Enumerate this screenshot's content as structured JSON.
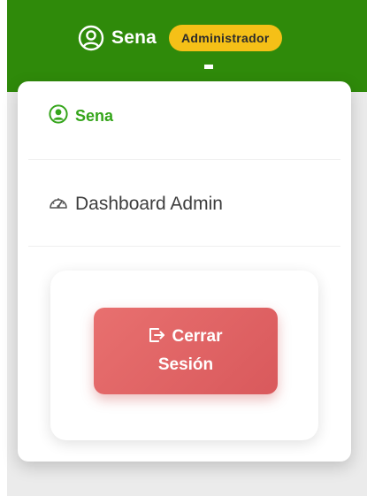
{
  "header": {
    "user_name": "Sena",
    "role_badge": "Administrador",
    "user_icon": "user-circle-icon",
    "bar_color": "#2f8a0a",
    "badge_color": "#f5c017"
  },
  "dropdown": {
    "user_item": {
      "label": "Sena",
      "icon": "user-circle-icon",
      "color": "#35a51b"
    },
    "dashboard_item": {
      "label": "Dashboard Admin",
      "icon": "speedometer-icon"
    },
    "logout_button": {
      "label": "Cerrar Sesión",
      "icon": "sign-out-icon",
      "color": "#e06565"
    }
  }
}
